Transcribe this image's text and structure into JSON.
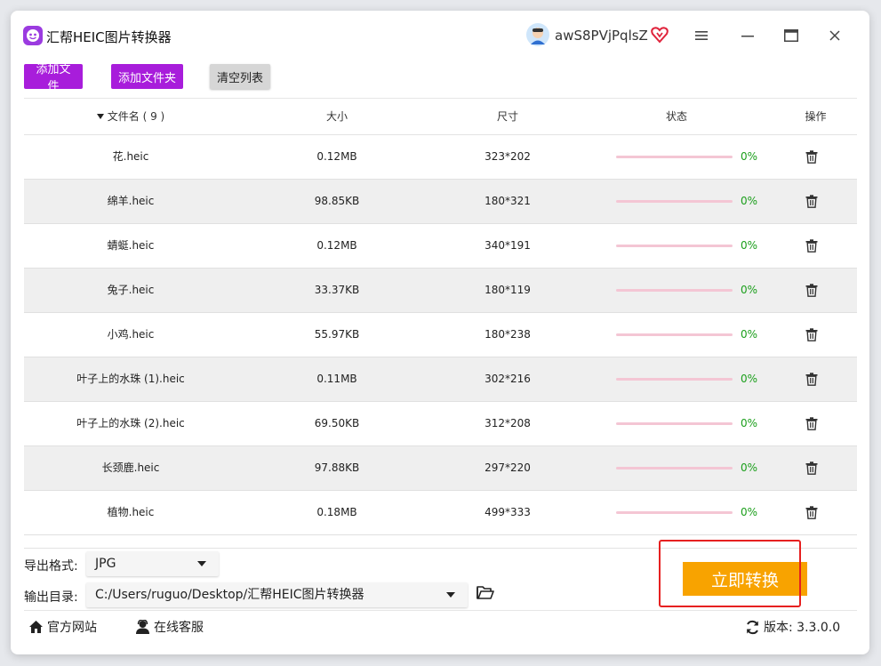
{
  "app": {
    "title": "汇帮HEIC图片转换器"
  },
  "user": {
    "name": "awS8PVjPqlsZ"
  },
  "toolbar": {
    "add_file": "添加文件",
    "add_folder": "添加文件夹",
    "clear_list": "清空列表"
  },
  "table": {
    "headers": {
      "name": "文件名 ( 9 )",
      "size": "大小",
      "dimensions": "尺寸",
      "status": "状态",
      "operation": "操作"
    },
    "rows": [
      {
        "name": "花.heic",
        "size": "0.12MB",
        "dimensions": "323*202",
        "progress": "0%",
        "progress_value": 0
      },
      {
        "name": "绵羊.heic",
        "size": "98.85KB",
        "dimensions": "180*321",
        "progress": "0%",
        "progress_value": 0
      },
      {
        "name": "蜻蜓.heic",
        "size": "0.12MB",
        "dimensions": "340*191",
        "progress": "0%",
        "progress_value": 0
      },
      {
        "name": "兔子.heic",
        "size": "33.37KB",
        "dimensions": "180*119",
        "progress": "0%",
        "progress_value": 0
      },
      {
        "name": "小鸡.heic",
        "size": "55.97KB",
        "dimensions": "180*238",
        "progress": "0%",
        "progress_value": 0
      },
      {
        "name": "叶子上的水珠 (1).heic",
        "size": "0.11MB",
        "dimensions": "302*216",
        "progress": "0%",
        "progress_value": 0
      },
      {
        "name": "叶子上的水珠 (2).heic",
        "size": "69.50KB",
        "dimensions": "312*208",
        "progress": "0%",
        "progress_value": 0
      },
      {
        "name": "长颈鹿.heic",
        "size": "97.88KB",
        "dimensions": "297*220",
        "progress": "0%",
        "progress_value": 0
      },
      {
        "name": "植物.heic",
        "size": "0.18MB",
        "dimensions": "499*333",
        "progress": "0%",
        "progress_value": 0
      }
    ]
  },
  "output": {
    "format_label": "导出格式:",
    "format_value": "JPG",
    "dir_label": "输出目录:",
    "dir_value": "C:/Users/ruguo/Desktop/汇帮HEIC图片转换器"
  },
  "convert_button": "立即转换",
  "footer": {
    "website": "官方网站",
    "support": "在线客服",
    "version": "版本: 3.3.0.0"
  },
  "colors": {
    "brand_purple": "#a81ddb",
    "convert_orange": "#f8a300",
    "progress_track": "#f4c6d4",
    "progress_text": "#1a9e1a",
    "highlight_red": "#e62020"
  },
  "icons": [
    "app-logo-icon",
    "user-avatar-icon",
    "vip-heart-icon",
    "menu-icon",
    "minimize-icon",
    "maximize-icon",
    "close-icon",
    "sort-down-icon",
    "trash-icon",
    "folder-open-icon",
    "home-icon",
    "support-agent-icon",
    "refresh-icon"
  ]
}
